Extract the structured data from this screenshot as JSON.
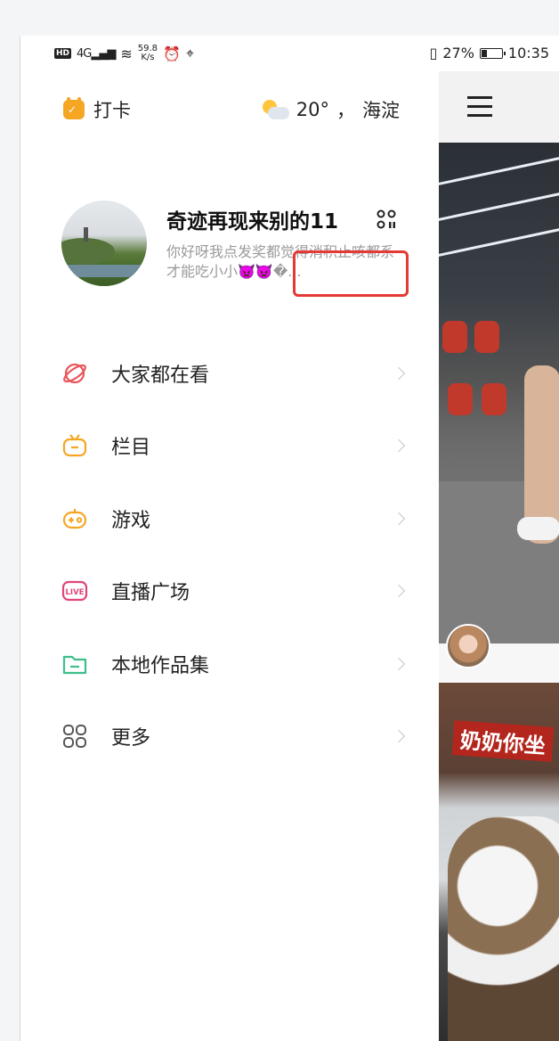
{
  "status_bar": {
    "hd": "HD",
    "network": "4G",
    "speed_value": "59.8",
    "speed_unit": "K/s",
    "battery": "27%",
    "time": "10:35",
    "battery_level": 0.27
  },
  "drawer": {
    "checkin_label": "打卡",
    "weather": {
      "temperature": "20°",
      "location": "海淀",
      "separator": "，"
    },
    "profile": {
      "name": "奇迹再现来别的11",
      "bio": "你好呀我点发奖都觉得消积止咳都系才能吃小小👿👿�..."
    },
    "menu": [
      {
        "label": "大家都在看",
        "icon": "planet-icon",
        "color": "#e8565a"
      },
      {
        "label": "栏目",
        "icon": "tv-icon",
        "color": "#f5a623"
      },
      {
        "label": "游戏",
        "icon": "gamepad-icon",
        "color": "#f5a623"
      },
      {
        "label": "直播广场",
        "icon": "live-icon",
        "color": "#e0457b"
      },
      {
        "label": "本地作品集",
        "icon": "folder-icon",
        "color": "#3dbf8b"
      },
      {
        "label": "更多",
        "icon": "grid-icon",
        "color": "#555555"
      }
    ]
  },
  "feed": {
    "caption": "奶奶你坐"
  }
}
